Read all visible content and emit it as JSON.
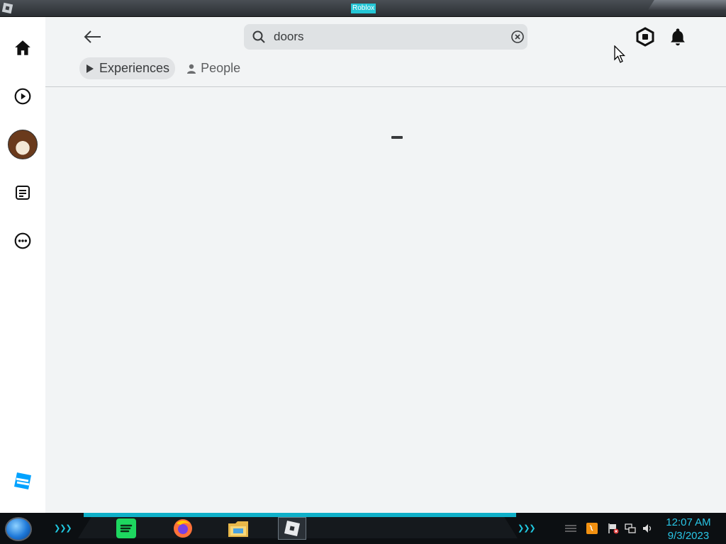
{
  "window": {
    "title": "Roblox"
  },
  "header": {
    "search": {
      "value": "doors",
      "placeholder": "Search"
    }
  },
  "tabs": [
    {
      "label": "Experiences",
      "active": true
    },
    {
      "label": "People",
      "active": false
    }
  ],
  "sidebar": {
    "items": [
      {
        "icon": "home-icon"
      },
      {
        "icon": "play-icon"
      },
      {
        "icon": "avatar"
      },
      {
        "icon": "chat-icon"
      },
      {
        "icon": "more-icon"
      }
    ]
  },
  "taskbar": {
    "apps": [
      "spotify-icon",
      "firefox-icon",
      "file-explorer-icon",
      "roblox-icon"
    ],
    "clock": {
      "time": "12:07 AM",
      "date": "9/3/2023"
    }
  },
  "colors": {
    "accent": "#00a2ff",
    "clock": "#29c6e6"
  }
}
